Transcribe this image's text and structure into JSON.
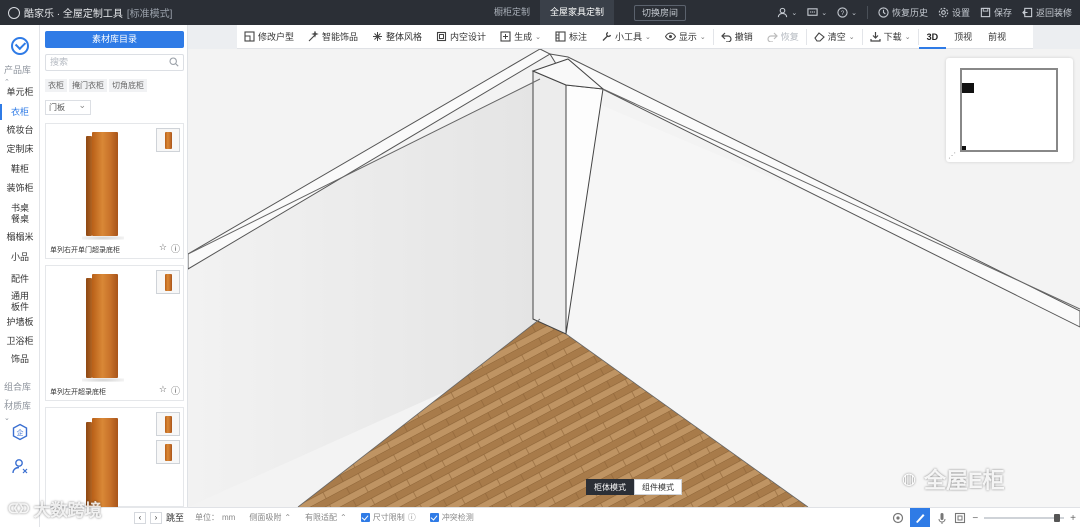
{
  "app": {
    "brand": "酷家乐 · 全屋定制工具",
    "mode": "[标准模式]"
  },
  "top_tabs": [
    {
      "label": "橱柜定制"
    },
    {
      "label": "全屋家具定制"
    }
  ],
  "switch_room": "切换房间",
  "top_right": {
    "restore_history": "恢复历史",
    "settings": "设置",
    "save": "保存",
    "back_to_design": "返回装修"
  },
  "rail": {
    "product_lib": "产品库",
    "combo_lib": "组合库",
    "material_lib": "材质库",
    "items": [
      "单元柜",
      "衣柜",
      "梳妆台",
      "定制床",
      "鞋柜",
      "装饰柜",
      "书桌\n餐桌",
      "榻榻米",
      "小品",
      "配件",
      "通用\n板件",
      "护墙板",
      "卫浴柜",
      "饰品"
    ],
    "active_index": 1
  },
  "panel": {
    "catalog_button": "素材库目录",
    "search_placeholder": "搜索",
    "breadcrumbs": [
      "衣柜",
      "掩门衣柜",
      "切角底柜"
    ],
    "filter": "门板",
    "products": [
      {
        "name": "单列右开单门超录底柜"
      },
      {
        "name": "单列左开超录底柜"
      },
      {
        "name": ""
      }
    ],
    "pager": {
      "jump": "跳至"
    }
  },
  "toolbar": {
    "items": [
      {
        "label": "修改户型",
        "icon": "floorplan-icon"
      },
      {
        "label": "智能饰品",
        "icon": "magic-icon"
      },
      {
        "label": "整体风格",
        "icon": "palette-icon"
      },
      {
        "label": "内空设计",
        "icon": "box-icon"
      },
      {
        "label": "生成",
        "icon": "generate-icon",
        "dropdown": true
      },
      {
        "label": "标注",
        "icon": "ruler-icon"
      },
      {
        "label": "小工具",
        "icon": "wrench-icon",
        "dropdown": true
      },
      {
        "label": "显示",
        "icon": "eye-icon",
        "dropdown": true
      },
      {
        "label": "撤销",
        "icon": "undo-icon"
      },
      {
        "label": "恢复",
        "icon": "redo-icon",
        "disabled": true
      },
      {
        "label": "清空",
        "icon": "eraser-icon",
        "dropdown": true
      },
      {
        "label": "下载",
        "icon": "download-icon",
        "dropdown": true
      }
    ],
    "views": [
      "3D",
      "顶视",
      "前视"
    ],
    "active_view": 0
  },
  "mode_switch": {
    "cabinet": "柜体模式",
    "component": "组件模式",
    "active": "cabinet"
  },
  "statusbar": {
    "unit_label": "单位：",
    "unit_value": "mm",
    "section_snap": "侧面吸附",
    "boundary_fit": "有限适配",
    "size_limit": "尺寸限制",
    "conflict_check": "冲突检测"
  },
  "watermarks": {
    "left": "大数跨境",
    "right": "全屋E柜"
  },
  "colors": {
    "accent": "#2f7be6",
    "topbar": "#2b2f36",
    "wood": "#c8722a"
  }
}
